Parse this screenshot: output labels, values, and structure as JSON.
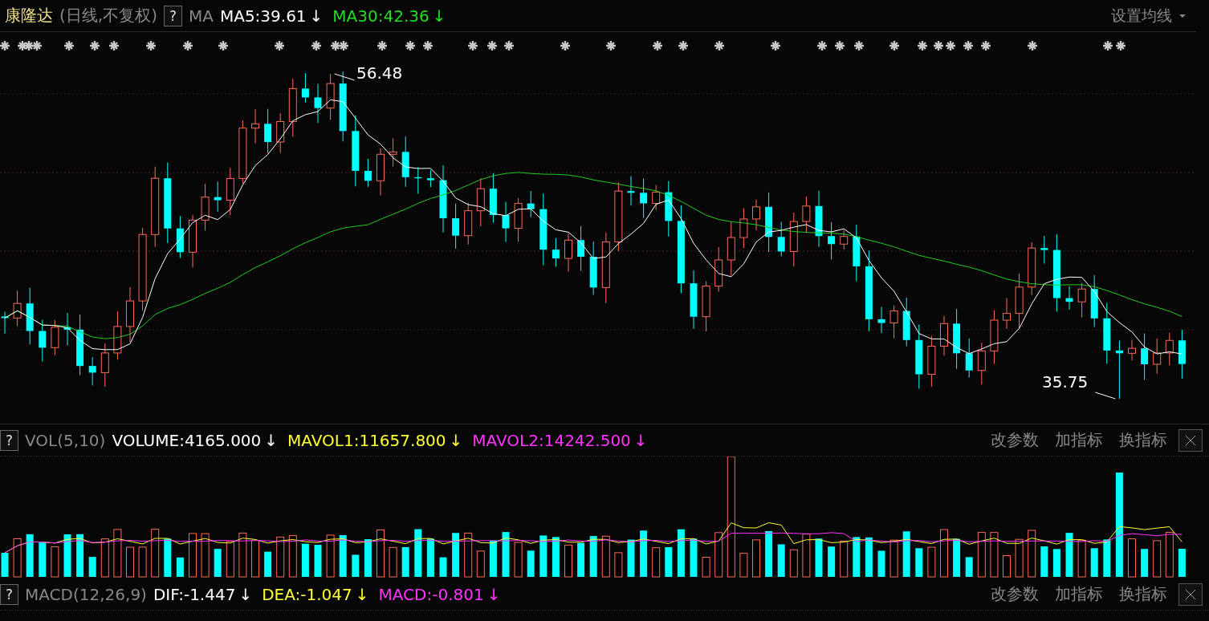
{
  "stock": {
    "name": "康隆达",
    "period": "(日线,不复权)",
    "help": "?",
    "indicator": "MA"
  },
  "ma_lines": [
    {
      "label": "MA5:39.61",
      "arrow": "↓",
      "color": "#ffffff"
    },
    {
      "label": "MA30:42.36",
      "arrow": "↓",
      "color": "#22dd22"
    }
  ],
  "ma_menu": {
    "label": "设置均线"
  },
  "price_chart": {
    "high_label": "56.48",
    "low_label": "35.75"
  },
  "panels": [
    {
      "help": "?",
      "name": "VOL(5,10)",
      "values": [
        {
          "label": "VOLUME:4165.000",
          "arrow": "↓",
          "color": "#ffffff"
        },
        {
          "label": "MAVOL1:11657.800",
          "arrow": "↓",
          "color": "#ffff33"
        },
        {
          "label": "MAVOL2:14242.500",
          "arrow": "↓",
          "color": "#ff33ff"
        }
      ],
      "actions": [
        "改参数",
        "加指标",
        "换指标"
      ]
    },
    {
      "help": "?",
      "name": "MACD(12,26,9)",
      "values": [
        {
          "label": "DIF:-1.447",
          "arrow": "↓",
          "color": "#ffffff"
        },
        {
          "label": "DEA:-1.047",
          "arrow": "↓",
          "color": "#ffff33"
        },
        {
          "label": "MACD:-0.801",
          "arrow": "↓",
          "color": "#ff33ff"
        }
      ],
      "actions": [
        "改参数",
        "加指标",
        "换指标"
      ]
    }
  ]
}
